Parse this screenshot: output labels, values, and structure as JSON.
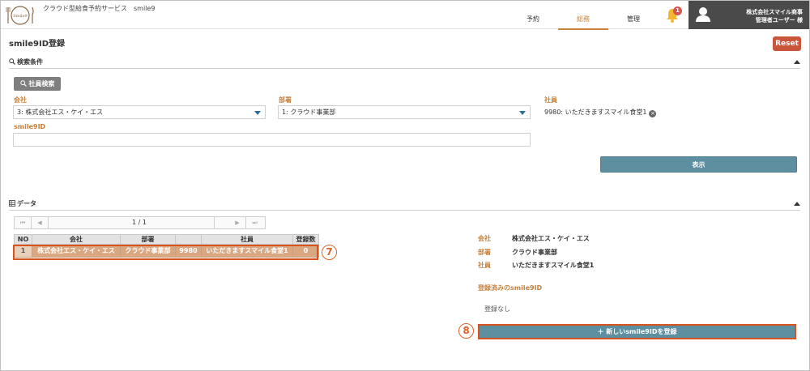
{
  "header": {
    "logo_text": "Smile9",
    "service_name": "クラウド型給食予約サービス　smile9",
    "nav": [
      {
        "label": "予約",
        "active": false
      },
      {
        "label": "総務",
        "active": true
      },
      {
        "label": "管理",
        "active": false
      }
    ],
    "notification_count": "1",
    "user_company": "株式会社スマイル商事",
    "user_name": "管理者ユーザー 様"
  },
  "page": {
    "title": "smile9ID登録",
    "reset_label": "Reset"
  },
  "search": {
    "section_title": "検索条件",
    "employee_search_label": "社員検索",
    "company_label": "会社",
    "company_value": "3: 株式会社エス・ケイ・エス",
    "department_label": "部署",
    "department_value": "1: クラウド事業部",
    "employee_label": "社員",
    "employee_value": "9980:  いただきますスマイル食堂1",
    "smile9id_label": "smile9ID",
    "smile9id_value": "",
    "show_label": "表示"
  },
  "data_section": {
    "section_title": "データ",
    "pager": {
      "first": "⏮",
      "prev": "◀",
      "info": "1 / 1",
      "next": "▶",
      "last": "⏭"
    },
    "columns": [
      "NO",
      "会社",
      "部署",
      "",
      "社員",
      "登録数"
    ],
    "rows": [
      [
        "1",
        "株式会社エス・ケイ・エス",
        "クラウド事業部",
        "9980",
        "いただきますスマイル食堂1",
        "0"
      ]
    ],
    "callout_row": "7"
  },
  "detail": {
    "company_label": "会社",
    "company_value": "株式会社エス・ケイ・エス",
    "department_label": "部署",
    "department_value": "クラウド事業部",
    "employee_label": "社員",
    "employee_value": "いただきますスマイル食堂1",
    "registered_label": "登録済みのsmile9ID",
    "registered_none": "登録なし",
    "new_button_label": "＋ 新しいsmile9IDを登録",
    "callout_button": "8"
  },
  "colors": {
    "accent": "#c8823e",
    "reset": "#c9553b",
    "primary_button": "#5d8fa1",
    "highlight_outline": "#d9531e",
    "selected_row": "#d9a882"
  }
}
